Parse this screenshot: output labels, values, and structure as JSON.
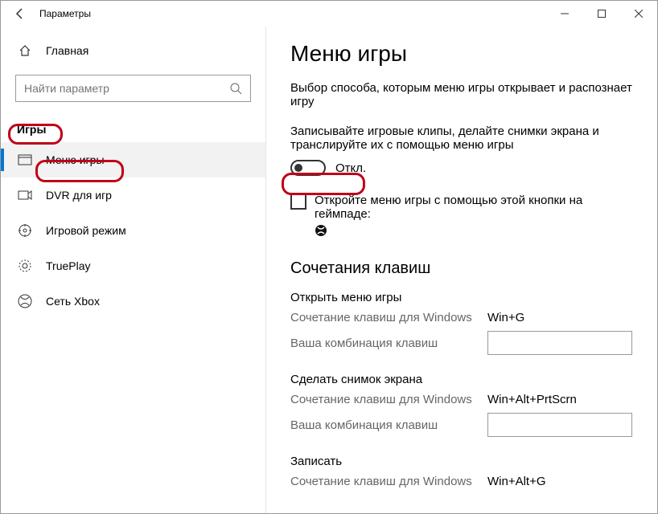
{
  "titlebar": {
    "title": "Параметры"
  },
  "sidebar": {
    "home": "Главная",
    "search_placeholder": "Найти параметр",
    "section": "Игры",
    "items": [
      {
        "label": "Меню игры"
      },
      {
        "label": "DVR для игр"
      },
      {
        "label": "Игровой режим"
      },
      {
        "label": "TruePlay"
      },
      {
        "label": "Сеть Xbox"
      }
    ]
  },
  "content": {
    "title": "Меню игры",
    "desc": "Выбор способа, которым меню игры открывает и распознает игру",
    "toggle_desc": "Записывайте игровые клипы, делайте снимки экрана и транслируйте их с помощью меню игры",
    "toggle_label": "Откл.",
    "check_label": "Откройте меню игры с помощью этой кнопки на геймпаде:",
    "shortcuts_title": "Сочетания клавиш",
    "shortcut_key_win": "Сочетание клавиш для Windows",
    "shortcut_key_custom": "Ваша комбинация клавиш",
    "shortcuts": [
      {
        "title": "Открыть меню игры",
        "win": "Win+G"
      },
      {
        "title": "Сделать снимок экрана",
        "win": "Win+Alt+PrtScrn"
      },
      {
        "title": "Записать",
        "win": "Win+Alt+G"
      }
    ]
  }
}
